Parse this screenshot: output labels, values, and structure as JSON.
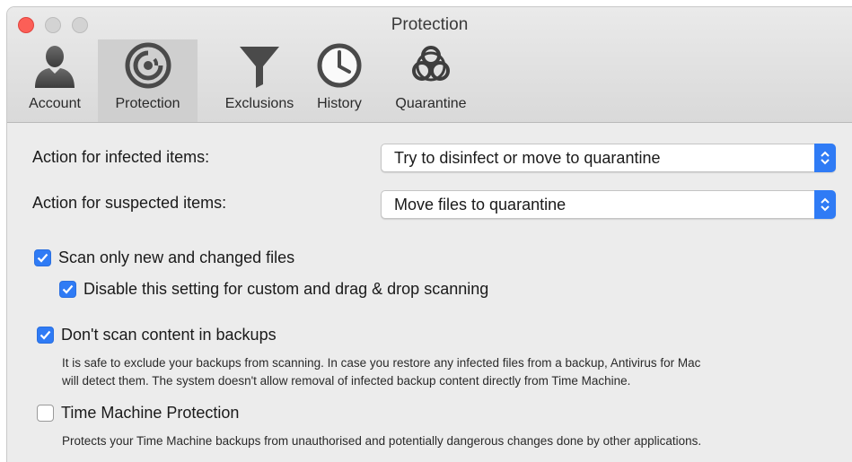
{
  "window": {
    "title": "Protection"
  },
  "toolbar": {
    "tabs": [
      {
        "label": "Account",
        "icon": "account-icon",
        "selected": false
      },
      {
        "label": "Protection",
        "icon": "protection-icon",
        "selected": true
      },
      {
        "label": "Exclusions",
        "icon": "funnel-icon",
        "selected": false
      },
      {
        "label": "History",
        "icon": "clock-icon",
        "selected": false
      },
      {
        "label": "Quarantine",
        "icon": "biohazard-icon",
        "selected": false
      }
    ]
  },
  "settings": {
    "infected": {
      "label": "Action for infected items:",
      "value": "Try to disinfect or move to quarantine"
    },
    "suspected": {
      "label": "Action for suspected items:",
      "value": "Move files to quarantine"
    },
    "scan_new": {
      "label": "Scan only new and changed files",
      "checked": true
    },
    "disable_custom": {
      "label": "Disable this setting for custom and drag & drop scanning",
      "checked": true
    },
    "backups": {
      "label": "Don't scan content in backups",
      "checked": true,
      "description_line1": "It is safe to exclude your backups from scanning. In case you restore any infected files from a backup, Antivirus for Mac",
      "description_line2": "will detect them. The system doesn't allow removal of infected backup content directly from Time Machine."
    },
    "time_machine": {
      "label": "Time Machine Protection",
      "checked": false,
      "description": "Protects your Time Machine backups from unauthorised and potentially dangerous changes done by other applications."
    }
  },
  "colors": {
    "accent": "#2f7bf5",
    "close": "#fc5f57",
    "selected_tab": "#cfcfcf"
  }
}
